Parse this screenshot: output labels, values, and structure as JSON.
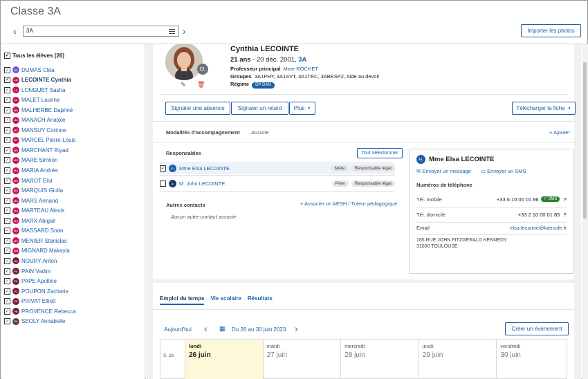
{
  "header": {
    "title": "Classe 3A",
    "class_value": "3A",
    "import_photos": "Importer les photos"
  },
  "sidebar": {
    "all_label": "Tous les élèves (26)",
    "students": [
      {
        "initials": "DC",
        "name": "DUMAS Cléa",
        "color": "#6d5bd0"
      },
      {
        "initials": "LC",
        "name": "LECOINTE Cynthia",
        "color": "#c2185b"
      },
      {
        "initials": "LS",
        "name": "LONGUET Sasha",
        "color": "#c2185b"
      },
      {
        "initials": "ML",
        "name": "MALET Laurine",
        "color": "#c2185b"
      },
      {
        "initials": "MD",
        "name": "MALHERBE Daphné",
        "color": "#c2185b"
      },
      {
        "initials": "MA",
        "name": "MANACH Anatole",
        "color": "#c2185b"
      },
      {
        "initials": "MC",
        "name": "MANSUY Corinne",
        "color": "#c2185b"
      },
      {
        "initials": "MP",
        "name": "MARCEL Pierre-Louis",
        "color": "#c2185b"
      },
      {
        "initials": "MR",
        "name": "MARCHANT Riyad",
        "color": "#c2185b"
      },
      {
        "initials": "MS",
        "name": "MARE Siméon",
        "color": "#c2185b"
      },
      {
        "initials": "MA",
        "name": "MARIA Andréa",
        "color": "#c2185b"
      },
      {
        "initials": "ME",
        "name": "MAROT Eloi",
        "color": "#c2185b"
      },
      {
        "initials": "MG",
        "name": "MARQUIS Giulia",
        "color": "#c2185b"
      },
      {
        "initials": "MA",
        "name": "MARS Armand",
        "color": "#c2185b"
      },
      {
        "initials": "MA",
        "name": "MARTEAU Alexis",
        "color": "#c2185b"
      },
      {
        "initials": "MA",
        "name": "MARX Abigail",
        "color": "#c2185b"
      },
      {
        "initials": "MS",
        "name": "MASSARD Soan",
        "color": "#c2185b"
      },
      {
        "initials": "MS",
        "name": "MENIER Stanislas",
        "color": "#c2185b"
      },
      {
        "initials": "MM",
        "name": "MIGNARD Makayla",
        "color": "#c2185b"
      },
      {
        "initials": "NA",
        "name": "NOURY Anton",
        "color": "#7b1e3a"
      },
      {
        "initials": "PV",
        "name": "PAIN Vadim",
        "color": "#7b1e3a"
      },
      {
        "initials": "PA",
        "name": "PAPE Apolline",
        "color": "#7b1e3a"
      },
      {
        "initials": "PZ",
        "name": "POUPON Zacharie",
        "color": "#7b1e3a"
      },
      {
        "initials": "PE",
        "name": "PRIVAT Elliott",
        "color": "#7b1e3a"
      },
      {
        "initials": "PR",
        "name": "PROVENCE Rebecca",
        "color": "#7b1e3a"
      },
      {
        "initials": "SA",
        "name": "SEOLY Annabelle",
        "color": "#5d4037"
      }
    ]
  },
  "student": {
    "initials": "CL",
    "name": "Cynthia LECOINTE",
    "age": "21 ans",
    "birth": " - 20 déc. 2001, ",
    "class": "3A",
    "prof_label": "Professeur principal",
    "prof_value": "Mme ROCHET",
    "groups_label": "Groupes",
    "groups_value": "3A1PHY, 3A1SVT, 3A1TEC, 3ABESP2, Aide au devoir",
    "regime_label": "Régime",
    "regime_value": "DP DAN"
  },
  "actions": {
    "absence": "Signaler une absence",
    "late": "Signaler un retard",
    "more": "Plus",
    "download": "Télécharger la fiche"
  },
  "accompagnement": {
    "label": "Modalités d'accompagnement",
    "value": "Aucune",
    "add": "Ajouter"
  },
  "responsables": {
    "title": "Responsables",
    "select_all": "Tout sélectionner",
    "items": [
      {
        "initials": "EL",
        "name": "Mme Elsa LECOINTE",
        "relation": "Mère",
        "role": "Responsable légal",
        "checked": "✓"
      },
      {
        "initials": "JL",
        "name": "M. John LECOINTE",
        "relation": "Père",
        "role": "Responsable légal",
        "checked": ""
      }
    ],
    "other_title": "Autres contacts",
    "associate": "Associer un AESH / Tuteur pédagogique",
    "none": "Aucun autre contact associé"
  },
  "contact": {
    "initials": "EL",
    "name": "Mme Elsa LECOINTE",
    "send_message": "Envoyer un message",
    "send_sms": "Envoyer un SMS",
    "phones_title": "Numéros de téléphone",
    "mobile_label": "Tél. mobile",
    "mobile": "+33 6 10 00 01 86",
    "sms_badge": "SMS",
    "home_label": "Tél. domicile",
    "home": "+33 2 10 00 01 85",
    "email_label": "Email",
    "email": "elsa.lecointe@kdecole.fr",
    "address1": "185 RUE JOHN FITZGERALD KENNEDY",
    "address2": "31000 TOULOUSE"
  },
  "tabs": [
    "Emploi du temps",
    "Vie scolaire",
    "Résultats"
  ],
  "calendar": {
    "today": "Aujourd'hui",
    "range": "Du 26 au 30 juin 2023",
    "create": "Créer un événement",
    "week": "S. 26",
    "days": [
      {
        "day": "lundi",
        "date": "26 juin"
      },
      {
        "day": "mardi",
        "date": "27 juin"
      },
      {
        "day": "mercredi",
        "date": "28 juin"
      },
      {
        "day": "jeudi",
        "date": "29 juin"
      },
      {
        "day": "vendredi",
        "date": "30 juin"
      }
    ]
  }
}
